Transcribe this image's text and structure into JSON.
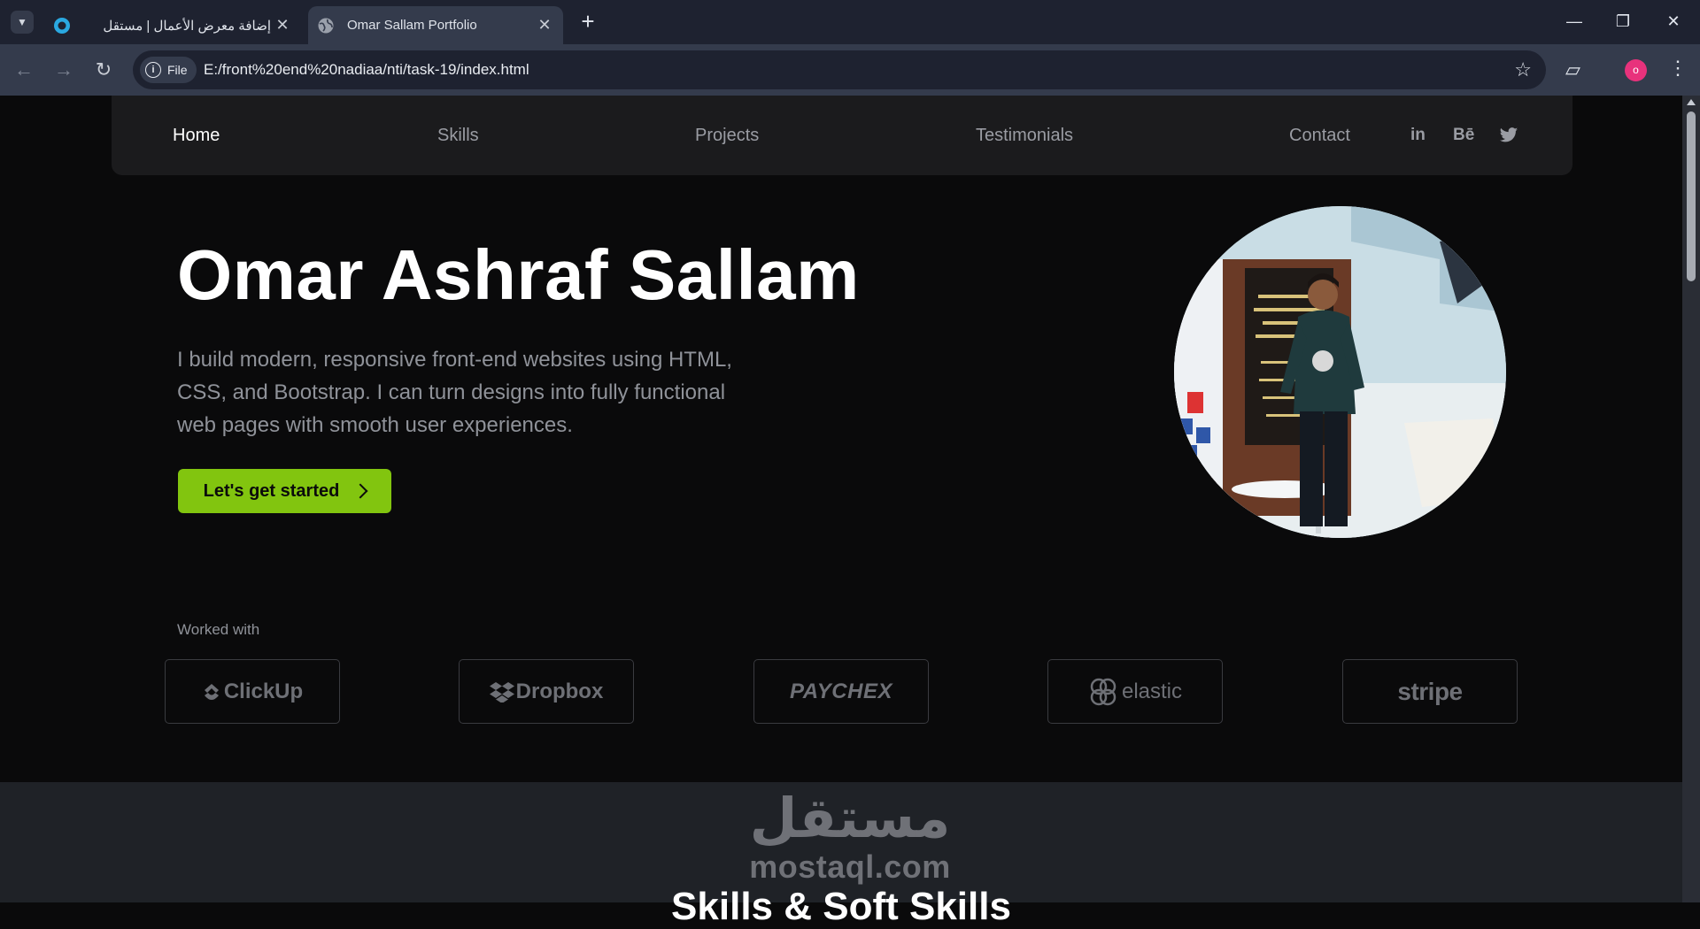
{
  "browser": {
    "tabs": [
      {
        "title": "إضافة معرض الأعمال | مستقل",
        "active": false
      },
      {
        "title": "Omar Sallam Portfolio",
        "active": true
      }
    ],
    "address": {
      "scheme_label": "File",
      "url": "E:/front%20end%20nadiaa/nti/task-19/index.html"
    },
    "profile_initial": "o",
    "profile_color": "#e8327c"
  },
  "nav": {
    "links": [
      "Home",
      "Skills",
      "Projects",
      "Testimonials",
      "Contact"
    ],
    "active": "Home",
    "social": [
      "linkedin-icon",
      "behance-icon",
      "twitter-icon"
    ],
    "social_text": {
      "linkedin": "in",
      "behance": "Bē"
    }
  },
  "hero": {
    "name": "Omar Ashraf Sallam",
    "description": "I build modern, responsive front-end websites using HTML, CSS, and Bootstrap. I can turn designs into fully functional web pages with smooth user experiences.",
    "cta_label": "Let's get started",
    "cta_color": "#82c50f"
  },
  "worked_with": {
    "label": "Worked with",
    "logos": [
      "ClickUp",
      "Dropbox",
      "PAYCHEX",
      "elastic",
      "stripe"
    ]
  },
  "watermark": {
    "arabic": "مستقل",
    "latin": "mostaql.com"
  },
  "next_section": {
    "heading": "Skills & Soft Skills"
  }
}
